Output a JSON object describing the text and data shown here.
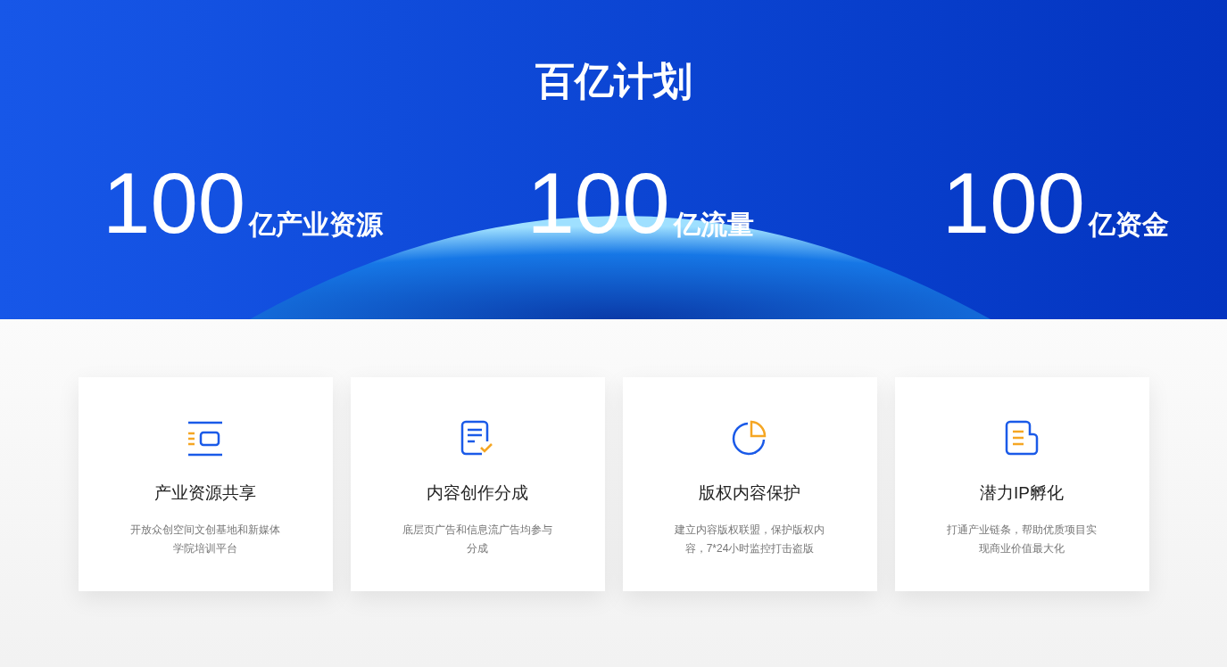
{
  "hero": {
    "title": "百亿计划",
    "stats": [
      {
        "number": "100",
        "unit": "亿产业资源"
      },
      {
        "number": "100",
        "unit": "亿流量"
      },
      {
        "number": "100",
        "unit": "亿资金"
      }
    ]
  },
  "cards": [
    {
      "kind": "resources",
      "title": "产业资源共享",
      "description": "开放众创空间文创基地和新媒体学院培训平台"
    },
    {
      "kind": "document-check",
      "title": "内容创作分成",
      "description": "底层页广告和信息流广告均参与分成"
    },
    {
      "kind": "pie",
      "title": "版权内容保护",
      "description": "建立内容版权联盟，保护版权内容，7*24小时监控打击盗版"
    },
    {
      "kind": "scroll",
      "title": "潜力IP孵化",
      "description": "打通产业链条，帮助优质项目实现商业价值最大化"
    }
  ]
}
